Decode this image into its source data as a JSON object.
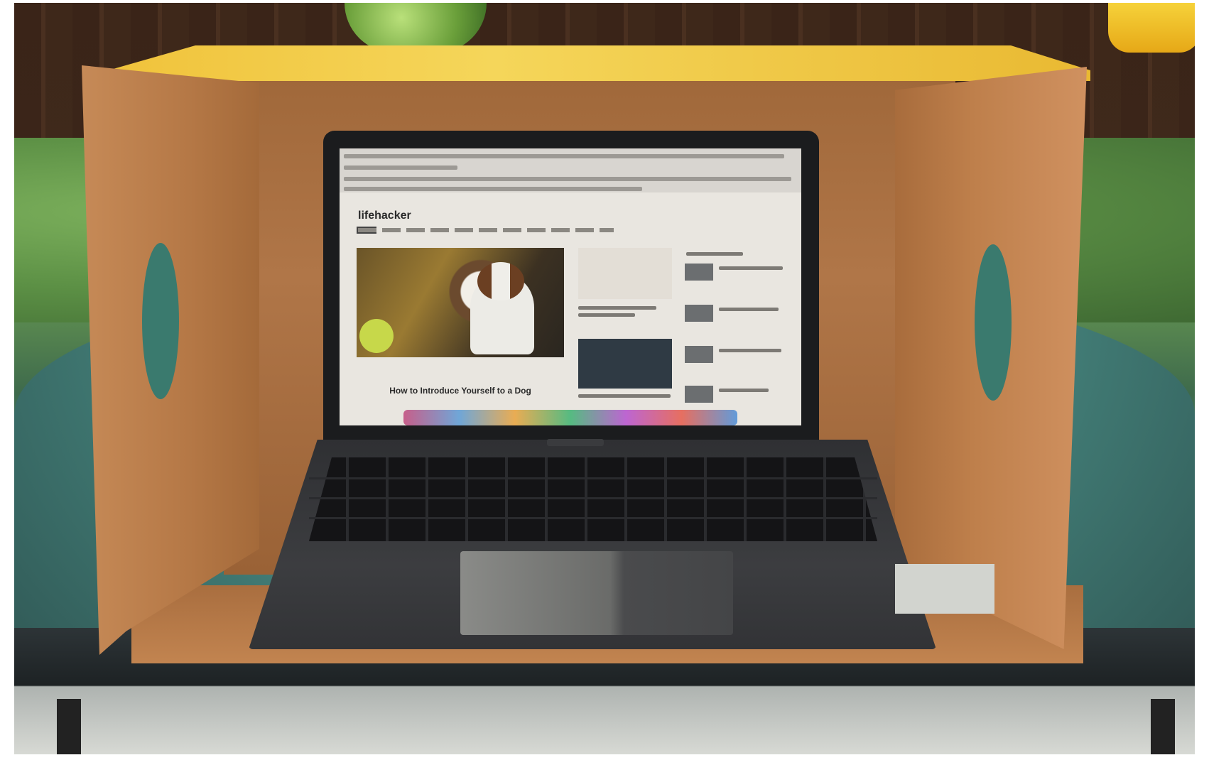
{
  "photo": {
    "alt": "",
    "screen_headline": "How to Introduce Yourself to a Dog",
    "site_logo_text": "lifehacker"
  }
}
